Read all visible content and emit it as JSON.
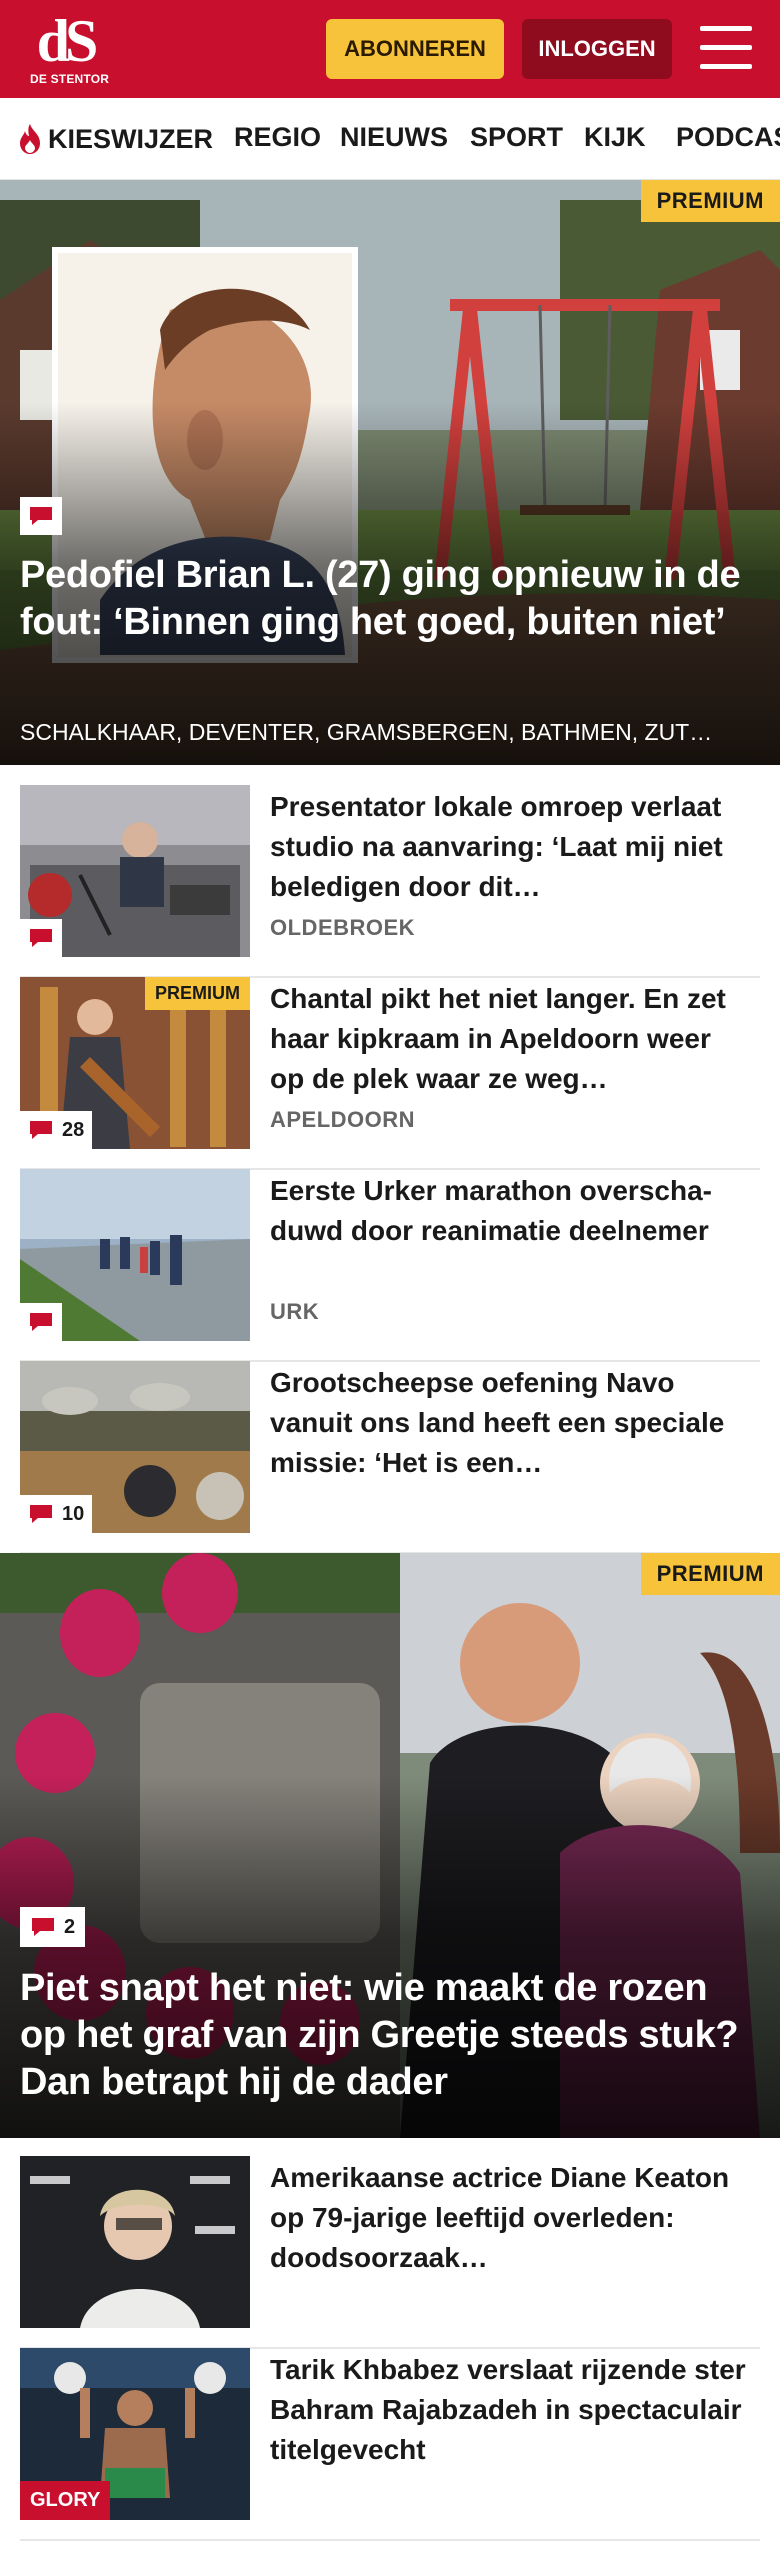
{
  "header": {
    "logo_mark": "dS",
    "logo_sub": "DE STENTOR",
    "subscribe_label": "ABONNEREN",
    "login_label": "INLOGGEN",
    "menu_icon": "hamburger-icon"
  },
  "nav": {
    "items": [
      {
        "label": "KIESWIJZER",
        "icon": "flame-icon"
      },
      {
        "label": "REGIO"
      },
      {
        "label": "NIEUWS"
      },
      {
        "label": "SPORT"
      },
      {
        "label": "KIJK"
      },
      {
        "label": "PODCAS"
      }
    ]
  },
  "colors": {
    "brand_red": "#c8102e",
    "premium_yellow": "#f6c33b",
    "login_dark_red": "#8f0b1e"
  },
  "hero1": {
    "premium": "PREMIUM",
    "title": "Pedofiel Brian L. (27) ging opnieuw in de fout: ‘Binnen ging het goed, buiten niet’",
    "kicker": "SCHALKHAAR, DEVENTER, GRAMSBERGEN, BATHMEN, ZUT…",
    "comment_icon": "comment-icon"
  },
  "articles1": [
    {
      "title": "Presentator lokale omroep verlaat studio na aanvaring: ‘Laat mij niet beledigen door dit…",
      "location": "OLDEBROEK",
      "comments": ""
    },
    {
      "title": "Chantal pikt het niet langer. En zet haar kipkraam in Apeldoorn weer op de plek waar ze weg…",
      "location": "APELDOORN",
      "comments": "28",
      "premium": "PREMIUM"
    },
    {
      "title": "Eerste Urker marathon overscha­duwd door reanimatie deelnemer",
      "location": "URK",
      "comments": ""
    },
    {
      "title": "Grootscheepse oefening Navo vanuit ons land heeft een speciale missie: ‘Het is een…",
      "location": "",
      "comments": "10"
    }
  ],
  "hero2": {
    "premium": "PREMIUM",
    "comments": "2",
    "title": "Piet snapt het niet: wie maakt de rozen op het graf van zijn Greetje steeds stuk? Dan betrapt hij de dader"
  },
  "articles2": [
    {
      "title": "Amerikaanse actrice Diane Keaton op 79-jarige leeftijd overleden: doodsoorzaak…"
    },
    {
      "title": "Tarik Khbabez verslaat rijzende ster Bahram Rajabzadeh in spectaculair titelgevecht",
      "tag": "GLORY"
    }
  ]
}
